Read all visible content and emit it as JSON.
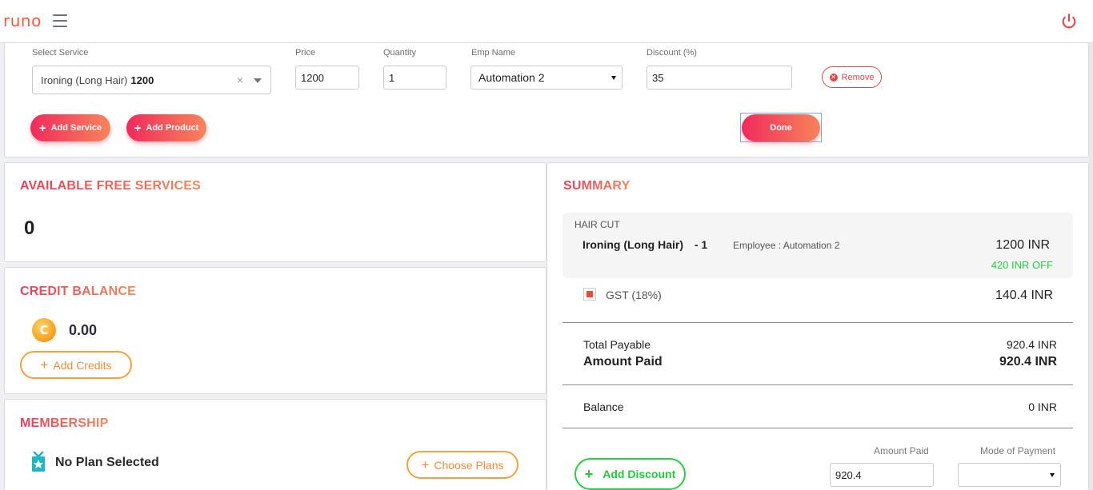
{
  "header": {
    "logo_text": "runo",
    "menu_icon": "hamburger-icon",
    "power_icon": "power-icon"
  },
  "service_form": {
    "select_service_label": "Select Service",
    "select_service_value": "Ironing (Long Hair)",
    "select_service_price": "1200",
    "clear_symbol": "×",
    "price_label": "Price",
    "price_value": "1200",
    "quantity_label": "Quantity",
    "quantity_value": "1",
    "emp_name_label": "Emp Name",
    "emp_name_value": "Automation 2",
    "discount_label": "Discount (%)",
    "discount_value": "35",
    "remove_label": "Remove",
    "add_service_label": "Add Service",
    "add_product_label": "Add Product",
    "done_label": "Done"
  },
  "free_services": {
    "title": "AVAILABLE FREE SERVICES",
    "count": "0"
  },
  "credit_balance": {
    "title": "CREDIT BALANCE",
    "coin_letter": "C",
    "value": "0.00",
    "add_credits_label": "Add Credits"
  },
  "membership": {
    "title": "MEMBERSHIP",
    "status": "No Plan Selected",
    "choose_plans_label": "Choose Plans"
  },
  "summary": {
    "title": "SUMMARY",
    "category": "HAIR CUT",
    "item_name": "Ironing (Long Hair)",
    "item_qty": "- 1",
    "item_employee": "Employee : Automation 2",
    "item_price": "1200  INR",
    "item_discount": "420 INR OFF",
    "gst_label": "GST (18%)",
    "gst_value": "140.4  INR",
    "total_payable_label": "Total Payable",
    "total_payable_value": "920.4 INR",
    "amount_paid_label": "Amount Paid",
    "amount_paid_value": "920.4 INR",
    "balance_label": "Balance",
    "balance_value": "0 INR",
    "amount_paid_field_label": "Amount Paid",
    "amount_paid_field_value": "920.4",
    "mode_of_payment_label": "Mode of Payment",
    "mode_of_payment_value": "",
    "add_discount_label": "Add Discount"
  },
  "colors": {
    "accent_gradient_start": "#f12a5c",
    "accent_gradient_end": "#f7845a",
    "remove_red": "#e24646",
    "discount_green": "#21cf3c",
    "credits_orange": "#f5a13a"
  }
}
